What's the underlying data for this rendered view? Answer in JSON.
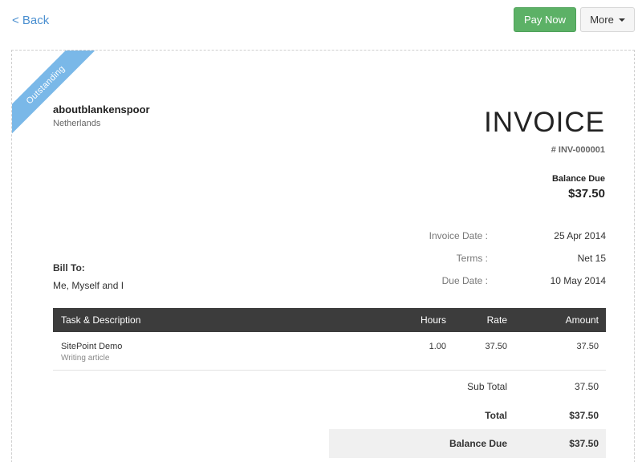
{
  "nav": {
    "back_label": "< Back"
  },
  "actions": {
    "pay_now_label": "Pay Now",
    "more_label": "More"
  },
  "ribbon": {
    "status_label": "Outstanding",
    "color": "#7ab8e8"
  },
  "org": {
    "name": "aboutblankenspoor",
    "country": "Netherlands"
  },
  "invoice": {
    "title": "INVOICE",
    "number": "# INV-000001",
    "balance_due_label": "Balance Due",
    "balance_due_value": "$37.50",
    "meta": [
      {
        "label": "Invoice Date :",
        "value": "25 Apr 2014"
      },
      {
        "label": "Terms :",
        "value": "Net 15"
      },
      {
        "label": "Due Date :",
        "value": "10 May 2014"
      }
    ]
  },
  "bill_to": {
    "label": "Bill To:",
    "name": "Me, Myself and I"
  },
  "table": {
    "headers": {
      "task": "Task & Description",
      "hours": "Hours",
      "rate": "Rate",
      "amount": "Amount"
    },
    "rows": [
      {
        "title": "SitePoint Demo",
        "description": "Writing article",
        "hours": "1.00",
        "rate": "37.50",
        "amount": "37.50"
      }
    ]
  },
  "totals": {
    "sub_total_label": "Sub Total",
    "sub_total_value": "37.50",
    "total_label": "Total",
    "total_value": "$37.50",
    "balance_due_label": "Balance Due",
    "balance_due_value": "$37.50"
  },
  "colors": {
    "accent_green": "#5cb166",
    "link_blue": "#4a8fd0",
    "table_header": "#3c3c3c"
  }
}
